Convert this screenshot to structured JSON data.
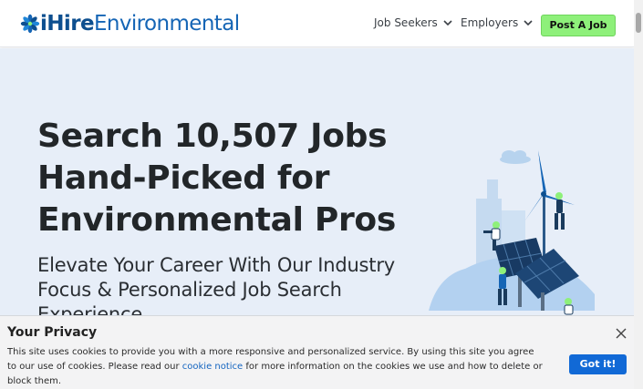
{
  "header": {
    "logo_ihire": "iHire",
    "logo_environmental": "Environmental",
    "nav": [
      {
        "label": "Job Seekers"
      },
      {
        "label": "Employers"
      }
    ],
    "post_job_label": "Post A Job"
  },
  "hero": {
    "headline_lines": [
      "Search 10,507 Jobs",
      "Hand-Picked for",
      "Environmental Pros"
    ],
    "subheadline_lines": [
      "Elevate Your Career With Our Industry",
      "Focus & Personalized Job Search",
      "Experience"
    ]
  },
  "privacy": {
    "title": "Your Privacy",
    "text_before_link": "This site uses cookies to provide you with a more responsive and personalized service. By using this site you agree to our use of cookies. Please read our ",
    "link_text": "cookie notice",
    "text_after_link": " for more information on the cookies we use and how to delete or block them.",
    "accept_label": "Got it!"
  },
  "icons": {
    "logo": "ihire-flower-logo-icon",
    "nav_chevron": "chevron-down-icon",
    "close": "close-icon",
    "illustration": "solar-panel-workers-illustration"
  },
  "colors": {
    "brand_blue": "#1565b5",
    "post_job_green": "#8ef07a",
    "hero_background": "#e7eef8",
    "accept_button": "#1169d6"
  }
}
